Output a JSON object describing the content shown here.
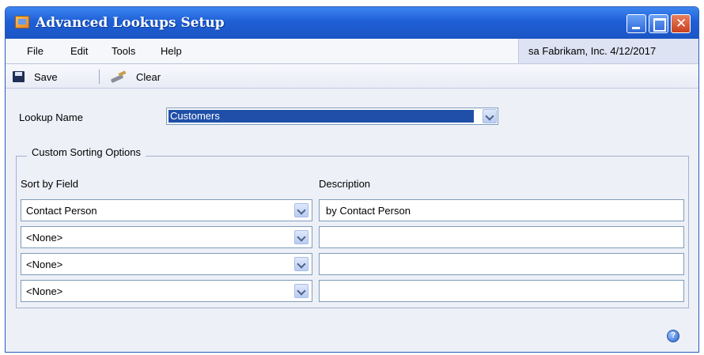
{
  "window": {
    "title": "Advanced Lookups Setup"
  },
  "menu": {
    "file": "File",
    "edit": "Edit",
    "tools": "Tools",
    "help": "Help"
  },
  "status": {
    "user": "sa",
    "company": "Fabrikam, Inc.",
    "date": "4/12/2017"
  },
  "toolbar": {
    "save_label": "Save",
    "clear_label": "Clear"
  },
  "lookup": {
    "label": "Lookup Name",
    "value": "Customers"
  },
  "sorting": {
    "legend": "Custom Sorting Options",
    "sort_header": "Sort by Field",
    "desc_header": "Description",
    "rows": [
      {
        "field": "Contact Person",
        "description": "by Contact Person"
      },
      {
        "field": "<None>",
        "description": ""
      },
      {
        "field": "<None>",
        "description": ""
      },
      {
        "field": "<None>",
        "description": ""
      }
    ]
  },
  "colors": {
    "title_bar": "#1f5fd6",
    "selection": "#1f4fa8"
  },
  "icons": {
    "app": "lookup-app-icon",
    "save": "disk-icon",
    "clear": "eraser-icon",
    "help": "help-icon",
    "minimize": "minimize-icon",
    "maximize": "maximize-icon",
    "close": "close-icon"
  }
}
